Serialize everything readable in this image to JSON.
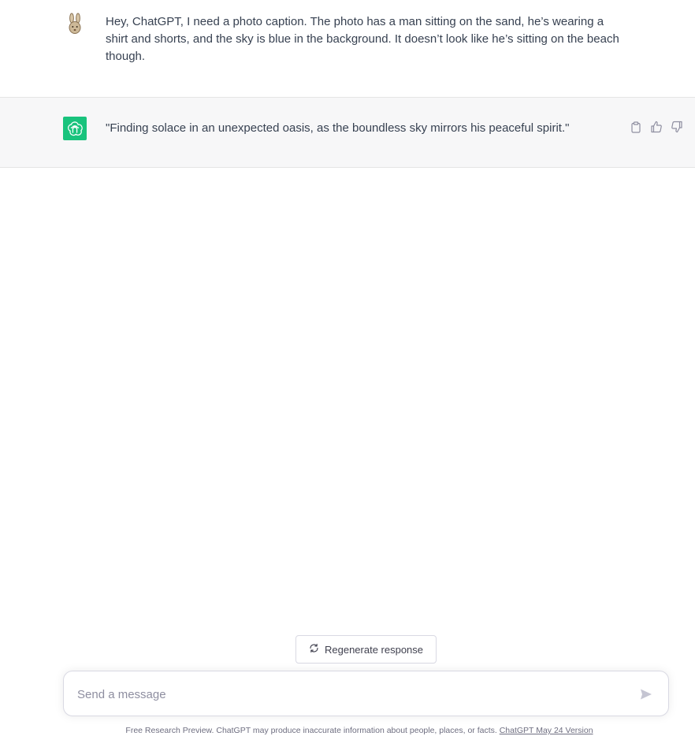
{
  "conversation": {
    "user_message": {
      "avatar_icon": "rabbit-avatar-icon",
      "text": "Hey, ChatGPT, I need a photo caption. The photo has a man sitting on the sand, he’s wearing a shirt and shorts, and the sky is blue in the background. It doesn’t look like he’s sitting on the beach though."
    },
    "assistant_message": {
      "avatar_icon": "openai-logo-icon",
      "text": "\"Finding solace in an unexpected oasis, as the boundless sky mirrors his peaceful spirit.\"",
      "actions": [
        "copy-icon",
        "thumbs-up-icon",
        "thumbs-down-icon"
      ]
    }
  },
  "regenerate": {
    "label": "Regenerate response",
    "icon": "refresh-icon"
  },
  "composer": {
    "placeholder": "Send a message",
    "value": "",
    "send_icon": "send-icon"
  },
  "footer": {
    "text": "Free Research Preview. ChatGPT may produce inaccurate information about people, places, or facts. ",
    "link_text": "ChatGPT May 24 Version"
  },
  "colors": {
    "accent": "#19c37d",
    "assistant_bg": "#f7f7f8",
    "text": "#374151",
    "muted": "#6e6e80"
  }
}
